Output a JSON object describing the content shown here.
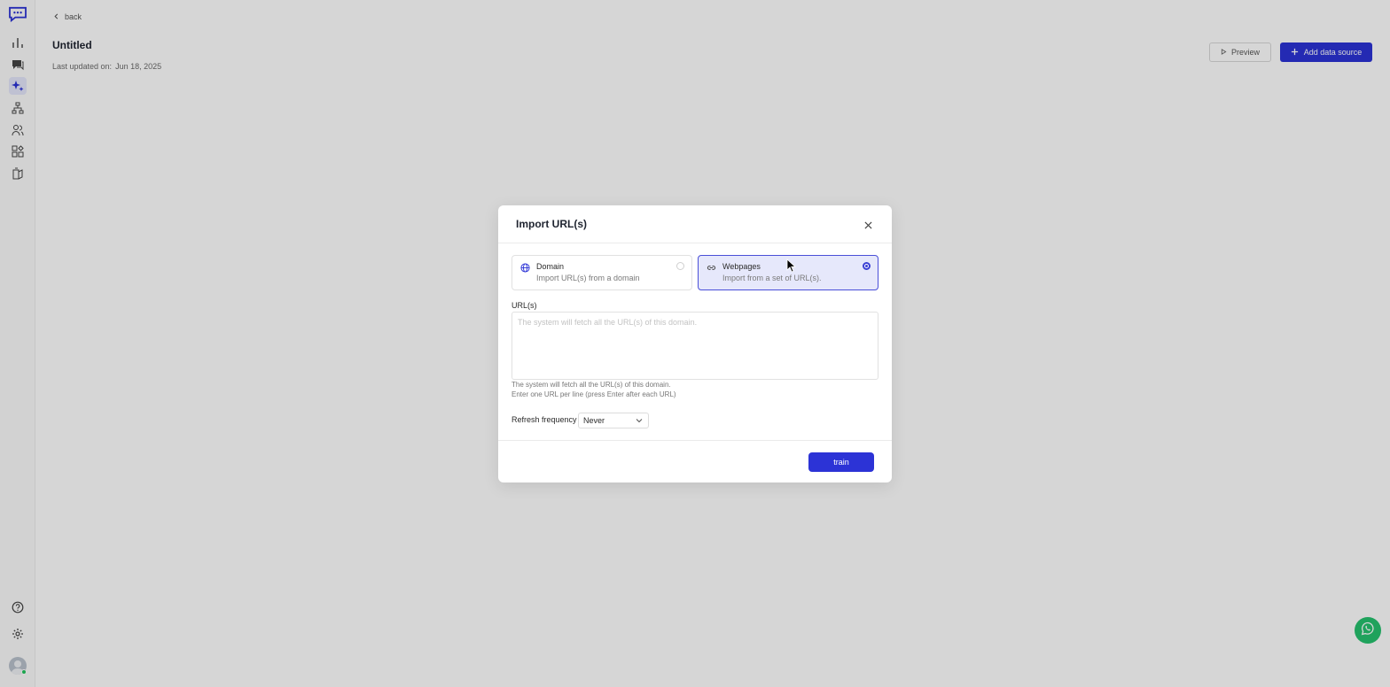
{
  "sidebar": {
    "icons": [
      "logo-chat-icon",
      "analytics-icon",
      "conversations-icon",
      "ai-sparkle-icon",
      "workflow-icon",
      "contacts-icon",
      "integrations-icon",
      "knowledge-icon",
      "help-icon",
      "settings-icon",
      "avatar"
    ]
  },
  "header": {
    "back_label": "back",
    "title": "Untitled",
    "last_updated_label": "Last updated on:",
    "last_updated_value": "Jun 18, 2025",
    "preview_label": "Preview",
    "add_source_label": "Add data source"
  },
  "modal": {
    "title": "Import URL(s)",
    "options": [
      {
        "title": "Domain",
        "desc": "Import URL(s) from a domain",
        "selected": false
      },
      {
        "title": "Webpages",
        "desc": "Import from a set of URL(s).",
        "selected": true
      }
    ],
    "url_label": "URL(s)",
    "url_value": "",
    "url_placeholder": "The system will fetch all the URL(s) of this domain.",
    "help_line1": "The system will fetch all the URL(s) of this domain.",
    "help_line2": "Enter one URL per line (press Enter after each URL)",
    "refresh_label": "Refresh frequency",
    "refresh_value": "Never",
    "train_label": "train"
  },
  "colors": {
    "accent": "#2c33d6",
    "selected_bg": "#e6e8fb",
    "whatsapp": "#25c26e",
    "online": "#22c55e"
  }
}
